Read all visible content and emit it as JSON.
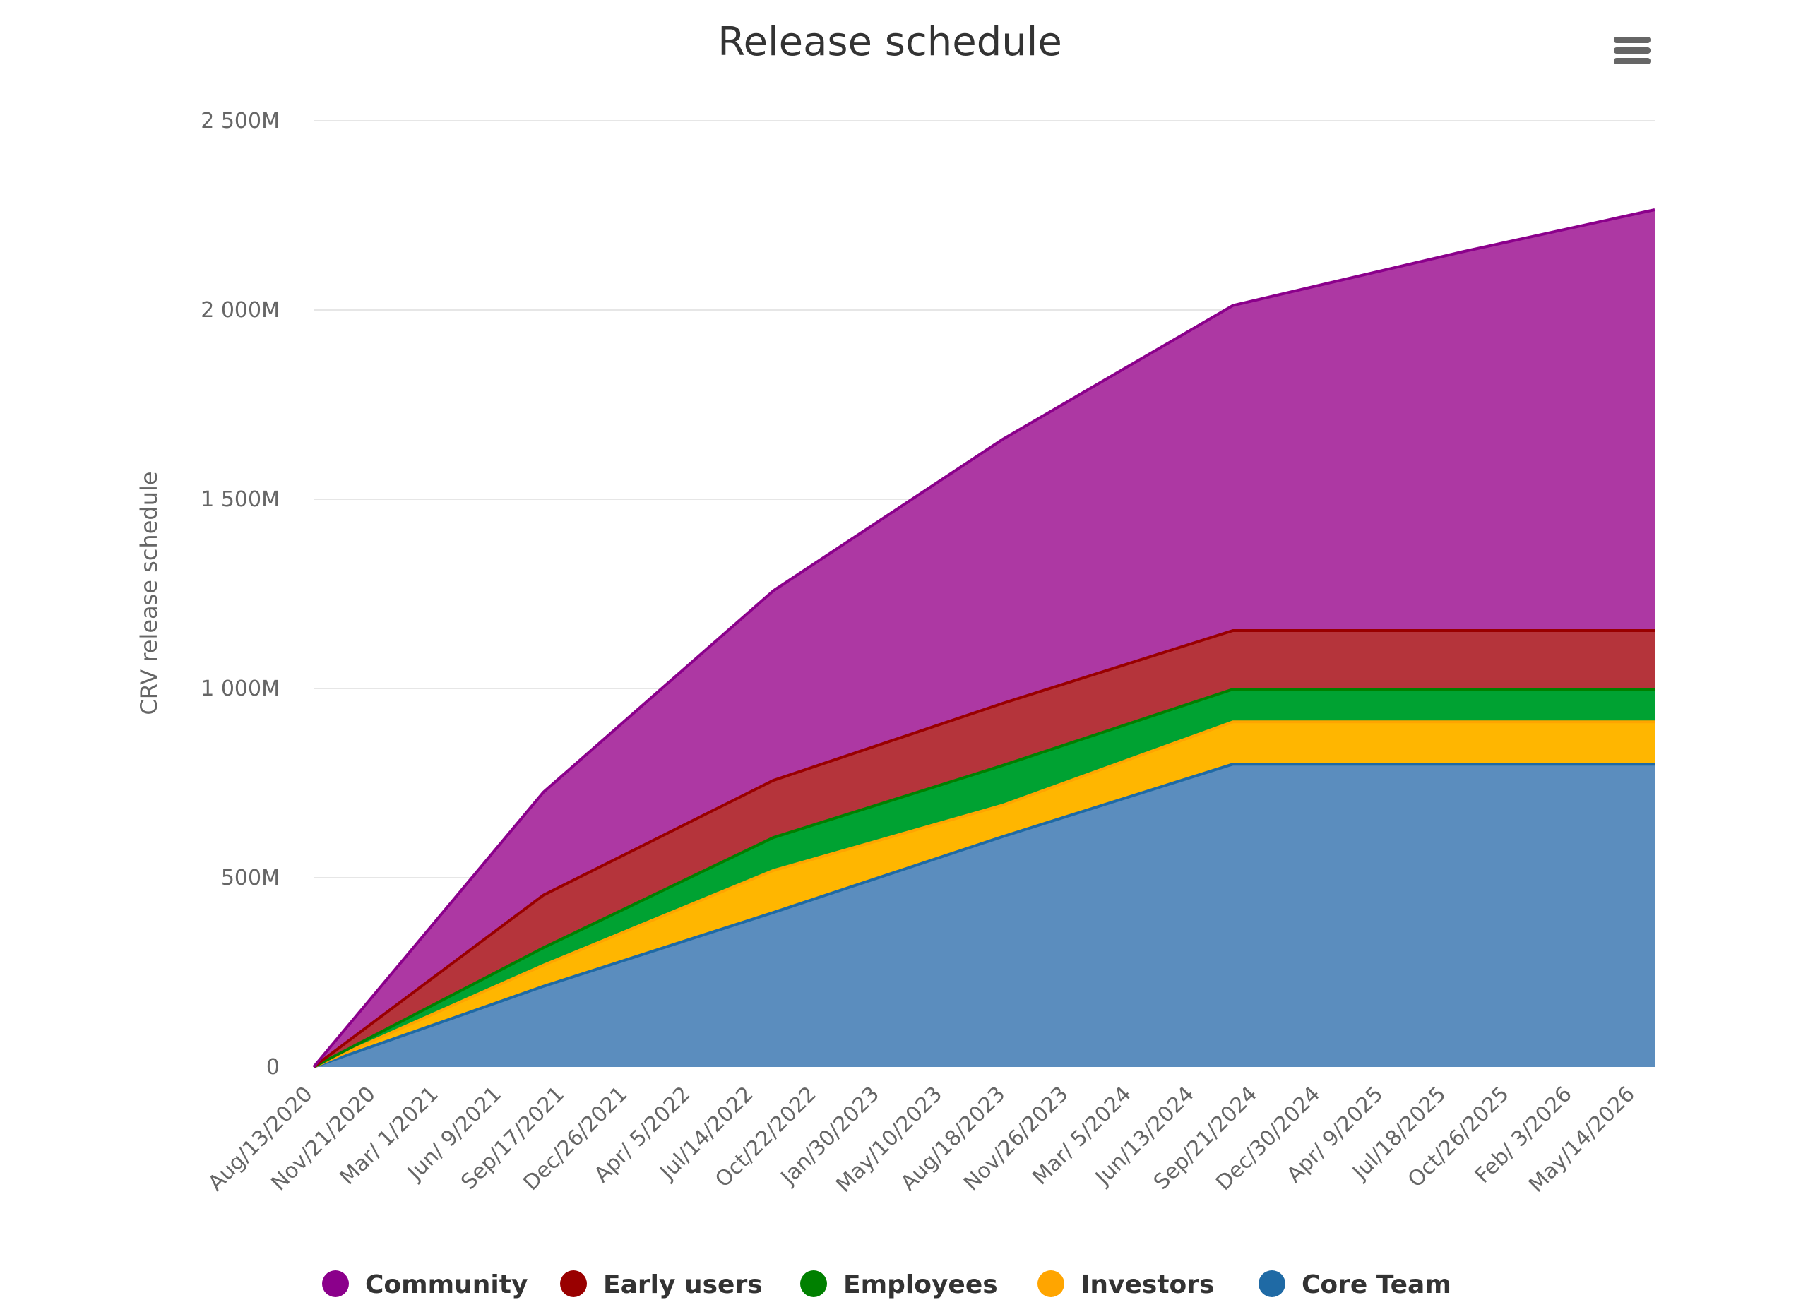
{
  "chart_data": {
    "type": "area",
    "stacking": "normal",
    "title": "Release schedule",
    "xlabel": "",
    "ylabel": "CRV release schedule",
    "ylim": [
      0,
      2500
    ],
    "y_unit": "M",
    "y_ticks": [
      {
        "value": 0,
        "label": "0"
      },
      {
        "value": 500,
        "label": "500M"
      },
      {
        "value": 1000,
        "label": "1 000M"
      },
      {
        "value": 1500,
        "label": "1 500M"
      },
      {
        "value": 2000,
        "label": "2 000M"
      },
      {
        "value": 2500,
        "label": "2 500M"
      }
    ],
    "x_tick_labels": [
      "Aug/13/2020",
      "Nov/21/2020",
      "Mar/ 1/2021",
      "Jun/ 9/2021",
      "Sep/17/2021",
      "Dec/26/2021",
      "Apr/ 5/2022",
      "Jul/14/2022",
      "Oct/22/2022",
      "Jan/30/2023",
      "May/10/2023",
      "Aug/18/2023",
      "Nov/26/2023",
      "Mar/ 5/2024",
      "Jun/13/2024",
      "Sep/21/2024",
      "Dec/30/2024",
      "Apr/ 9/2025",
      "Jul/18/2025",
      "Oct/26/2025",
      "Feb/ 3/2026",
      "May/14/2026"
    ],
    "x_tick_days": [
      0,
      100,
      200,
      300,
      400,
      500,
      600,
      700,
      800,
      900,
      1000,
      1100,
      1200,
      1300,
      1400,
      1500,
      1600,
      1700,
      1800,
      1900,
      2000,
      2100
    ],
    "x_range_days": [
      0,
      2130
    ],
    "x_days": [
      0,
      365,
      730,
      1095,
      1460,
      1825,
      2130
    ],
    "x": [
      "Aug/13/2020",
      "Aug/13/2021",
      "Aug/13/2022",
      "Aug/13/2023",
      "Aug/12/2024",
      "Aug/12/2025",
      "Jun/13/2026"
    ],
    "grid": true,
    "legend_position": "bottom",
    "series": [
      {
        "name": "Community",
        "color": "#8b008b",
        "fill": "#ad38a3",
        "values": [
          0,
          272,
          501,
          698,
          859,
          1001,
          1112
        ]
      },
      {
        "name": "Early users",
        "color": "#990000",
        "fill": "#b5343b",
        "values": [
          0,
          139,
          151,
          164,
          155,
          155,
          155
        ]
      },
      {
        "name": "Employees",
        "color": "#008000",
        "fill": "#00a232",
        "values": [
          0,
          46,
          87,
          105,
          86,
          86,
          86
        ]
      },
      {
        "name": "Investors",
        "color": "#ffa500",
        "fill": "#ffb600",
        "values": [
          0,
          56,
          111,
          83,
          112,
          112,
          112
        ]
      },
      {
        "name": "Core Team",
        "color": "#1f6aa5",
        "fill": "#5b8dbe",
        "values": [
          0,
          213,
          408,
          609,
          800,
          800,
          800
        ]
      }
    ]
  },
  "menu": {
    "icon": "hamburger-menu-icon"
  }
}
